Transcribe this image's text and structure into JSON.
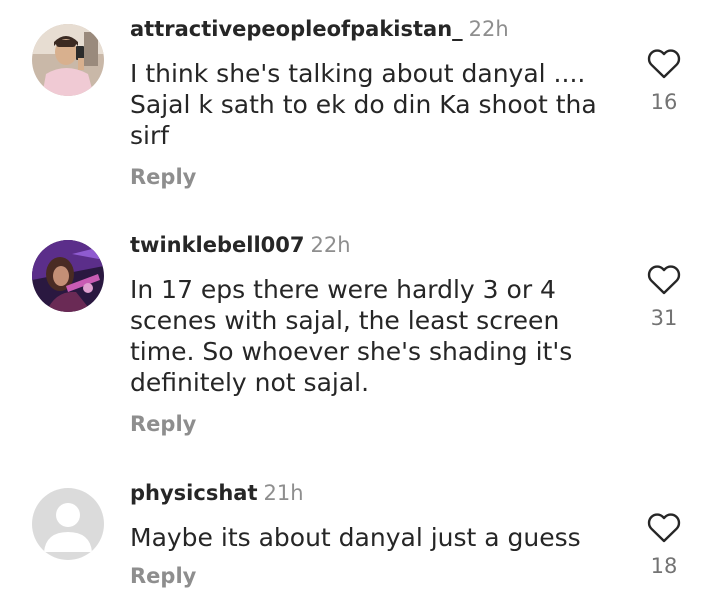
{
  "comments": [
    {
      "username": "attractivepeopleofpakistan_",
      "time": "22h",
      "text": "I think she's talking about danyal .... Sajal k sath to ek do din Ka shoot tha sirf",
      "reply_label": "Reply",
      "like_count": "16",
      "avatar_icon": "photo-avatar"
    },
    {
      "username": "twinklebell007",
      "time": "22h",
      "text": "In 17 eps there were hardly 3 or 4 scenes with sajal, the least screen time. So whoever she's shading it's definitely not sajal.",
      "reply_label": "Reply",
      "like_count": "31",
      "avatar_icon": "photo-avatar"
    },
    {
      "username": "physicshat",
      "time": "21h",
      "text": "Maybe its about danyal just a guess",
      "reply_label": "Reply",
      "like_count": "18",
      "avatar_icon": "default-user-avatar"
    }
  ],
  "colors": {
    "text_primary": "#262626",
    "text_secondary": "#8e8e8e",
    "like_count": "#737373",
    "default_avatar_bg": "#dbdbdb"
  }
}
